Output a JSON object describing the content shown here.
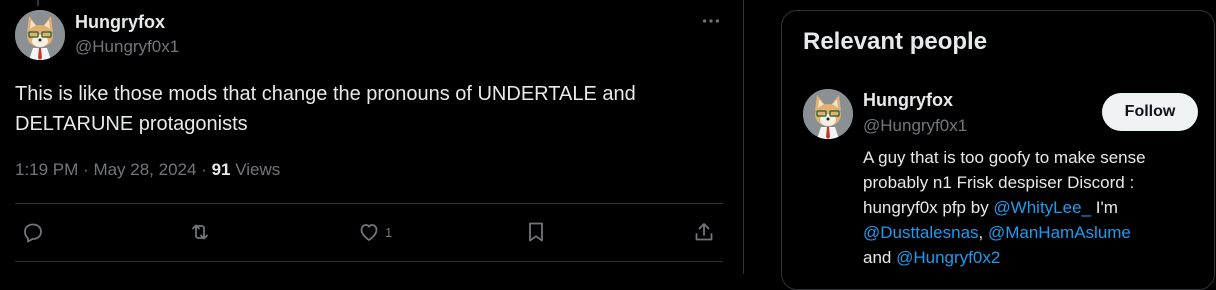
{
  "tweet": {
    "author_name": "Hungryfox",
    "author_handle": "@Hungryf0x1",
    "text_line1": "This is like those mods that change the pronouns of UNDERTALE and",
    "text_line2": "DELTARUNE protagonists",
    "time": "1:19 PM",
    "date": "May 28, 2024",
    "views_count": "91",
    "views_label": "Views",
    "likes_count": "1",
    "more_label": "···"
  },
  "sidebar": {
    "title": "Relevant people",
    "person": {
      "name": "Hungryfox",
      "handle": "@Hungryf0x1",
      "follow_label": "Follow",
      "bio": {
        "line1": "A guy that is too goofy to make sense",
        "line2": "probably n1 Frisk despiser Discord :",
        "line3_text": "hungryf0x pfp by ",
        "mention1": "@WhityLee_",
        "line3_tail": " I'm",
        "mention2": "@Dusttalesnas",
        "sep": ", ",
        "mention3": "@ManHamAslume",
        "and": "and ",
        "mention4": "@Hungryf0x2"
      }
    }
  },
  "colors": {
    "background": "#000000",
    "text": "#e7e9ea",
    "muted": "#71767b",
    "link": "#1d9bf0",
    "border": "#2f3336"
  },
  "icons": [
    "more-icon",
    "reply-icon",
    "retweet-icon",
    "like-icon",
    "bookmark-icon",
    "share-icon"
  ]
}
